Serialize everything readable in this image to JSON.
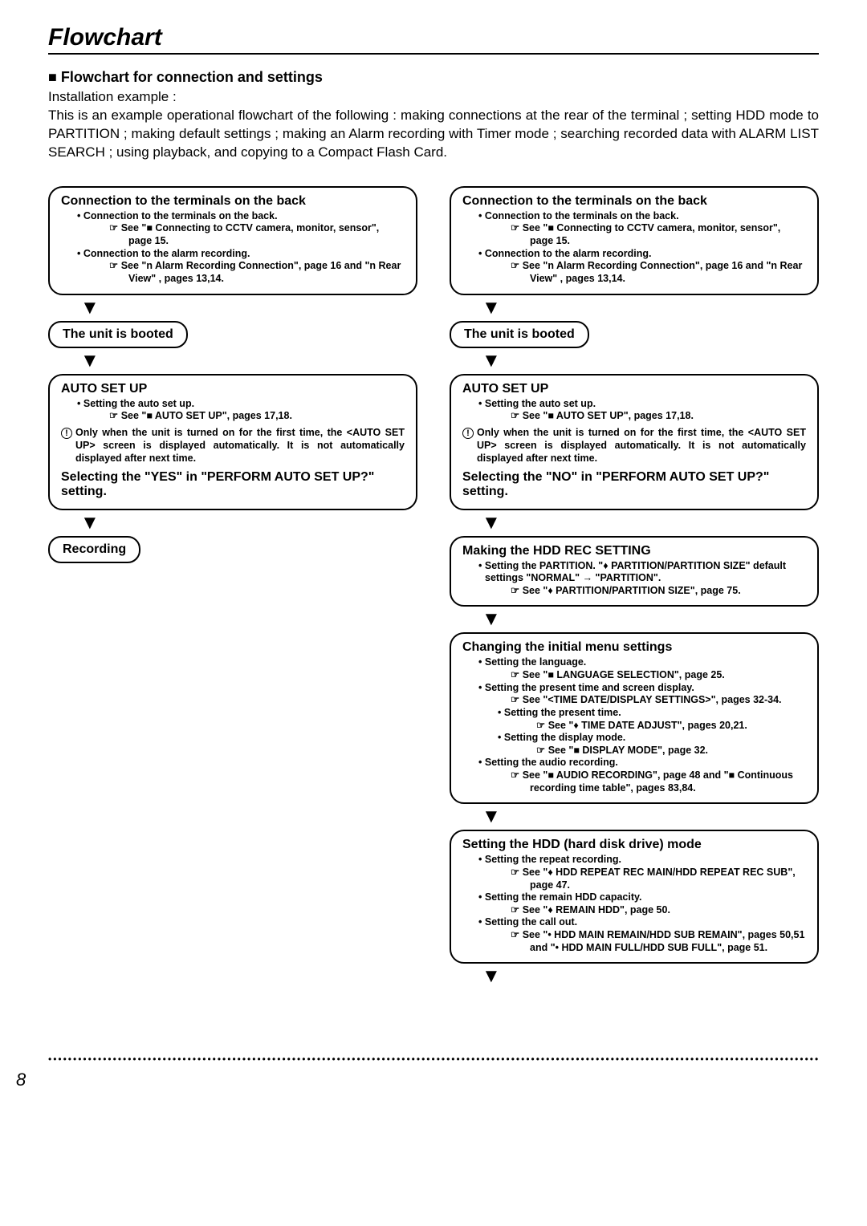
{
  "title": "Flowchart",
  "section_heading": "■ Flowchart for connection and settings",
  "intro_line": "Installation example :",
  "intro_para": "This is an example operational flowchart of the following : making connections at the rear of the terminal ; setting HDD mode to PARTITION ; making default settings ; making an Alarm recording with Timer mode ; searching recorded data with ALARM LIST SEARCH ; using playback, and copying to a Compact Flash Card.",
  "boxes": {
    "conn_title": "Connection to the terminals on the back",
    "conn_b1": "Connection to the terminals on the back.",
    "conn_r1": "See \"■ Connecting to CCTV camera, monitor, sensor\", page 15.",
    "conn_b2": "Connection to the alarm recording.",
    "conn_r2": "See \"n Alarm Recording Connection\", page 16 and \"n Rear View\" , pages 13,14.",
    "booted": "The unit is booted",
    "autoset_title": "AUTO SET UP",
    "autoset_b1": "Setting the auto set up.",
    "autoset_r1": "See \"■ AUTO SET UP\", pages 17,18.",
    "autoset_note": "Only when the unit is turned on for the first time, the <AUTO SET UP> screen is displayed automatically. It is not automatically displayed after next time.",
    "yes_title": "Selecting the \"YES\" in \"PERFORM AUTO SET UP?\" setting.",
    "no_title": "Selecting the \"NO\" in \"PERFORM AUTO SET UP?\" setting.",
    "recording": "Recording",
    "hddrec_title": "Making the HDD REC SETTING",
    "hddrec_b1": "Setting the PARTITION.  \"♦ PARTITION/PARTITION SIZE\" default settings \"NORMAL\" →   \"PARTITION\".",
    "hddrec_r1": "See \"♦ PARTITION/PARTITION SIZE\", page 75.",
    "initmenu_title": "Changing the initial menu settings",
    "initmenu_b1": "Setting the language.",
    "initmenu_r1": "See \"■ LANGUAGE SELECTION\", page 25.",
    "initmenu_b2": "Setting the present time and screen display.",
    "initmenu_r2": "See \"<TIME DATE/DISPLAY SETTINGS>\", pages 32-34.",
    "initmenu_b2a": "Setting the present time.",
    "initmenu_r2a": "See \"♦ TIME DATE ADJUST\", pages 20,21.",
    "initmenu_b2b": "Setting the display mode.",
    "initmenu_r2b": "See \"■ DISPLAY MODE\", page 32.",
    "initmenu_b3": "Setting the audio recording.",
    "initmenu_r3": "See \"■ AUDIO RECORDING\", page 48 and \"■ Continuous recording time table\", pages 83,84.",
    "hddmode_title": "Setting the HDD (hard disk drive) mode",
    "hddmode_b1": "Setting the repeat recording.",
    "hddmode_r1": "See \"♦ HDD REPEAT REC MAIN/HDD REPEAT REC SUB\",  page 47.",
    "hddmode_b2": "Setting the remain HDD capacity.",
    "hddmode_r2": "See \"♦ REMAIN HDD\", page 50.",
    "hddmode_b3": "Setting the call out.",
    "hddmode_r3": "See \"• HDD MAIN REMAIN/HDD SUB REMAIN\", pages 50,51 and \"• HDD MAIN FULL/HDD SUB FULL\", page 51."
  },
  "page_number": "8"
}
